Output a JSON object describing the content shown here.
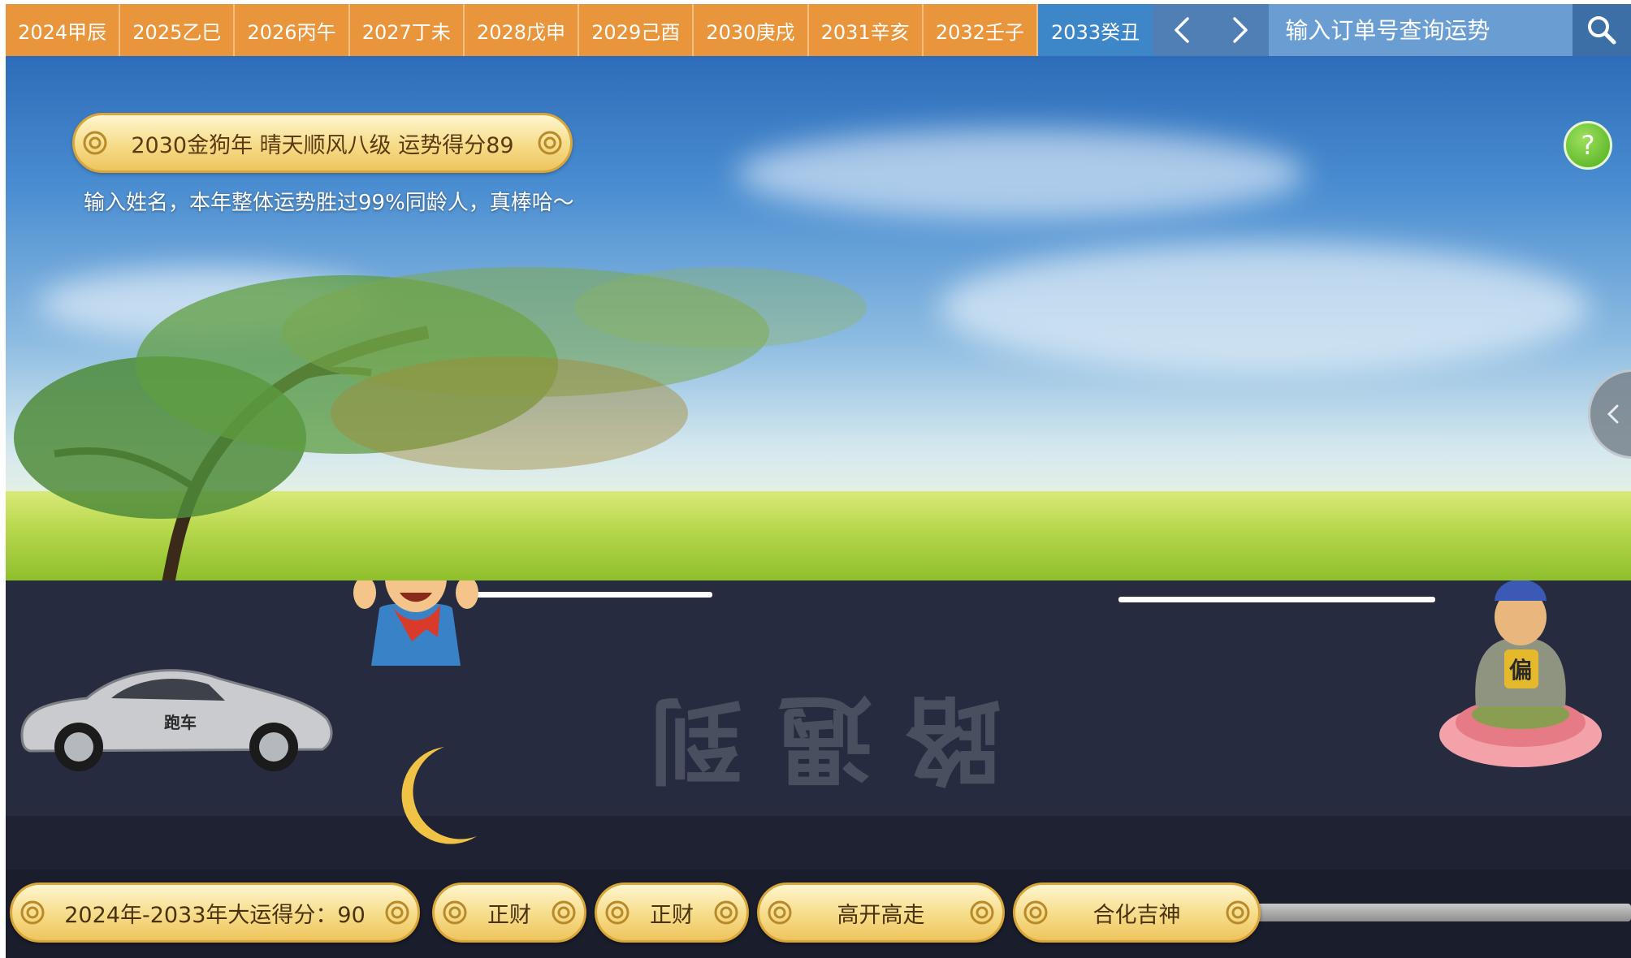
{
  "tabs": {
    "years": [
      "2024甲辰",
      "2025乙巳",
      "2026丙午",
      "2027丁未",
      "2028戊申",
      "2029己酉",
      "2030庚戌",
      "2031辛亥",
      "2032壬子",
      "2033癸丑"
    ],
    "active_year": "2033癸丑"
  },
  "search": {
    "placeholder": "输入订单号查询运势"
  },
  "banner": {
    "score_text": "2030金狗年 晴天顺风八级 运势得分89",
    "subtitle": "输入姓名，本年整体运势胜过99%同龄人，真棒哈～"
  },
  "help": {
    "label": "?"
  },
  "scene": {
    "road_text": "路遇到",
    "car_label": "跑车",
    "buddha_badge": "偏"
  },
  "bottom": {
    "decade_score": "2024年-2033年大运得分：90",
    "tag1": "正财",
    "tag2": "正财",
    "tag3": "高开高走",
    "tag4": "合化吉神"
  },
  "colors": {
    "tab_orange": "#e8953c",
    "tab_active": "#3d87c8",
    "pill_gold": "#f6dc88",
    "road": "#262b3f"
  }
}
